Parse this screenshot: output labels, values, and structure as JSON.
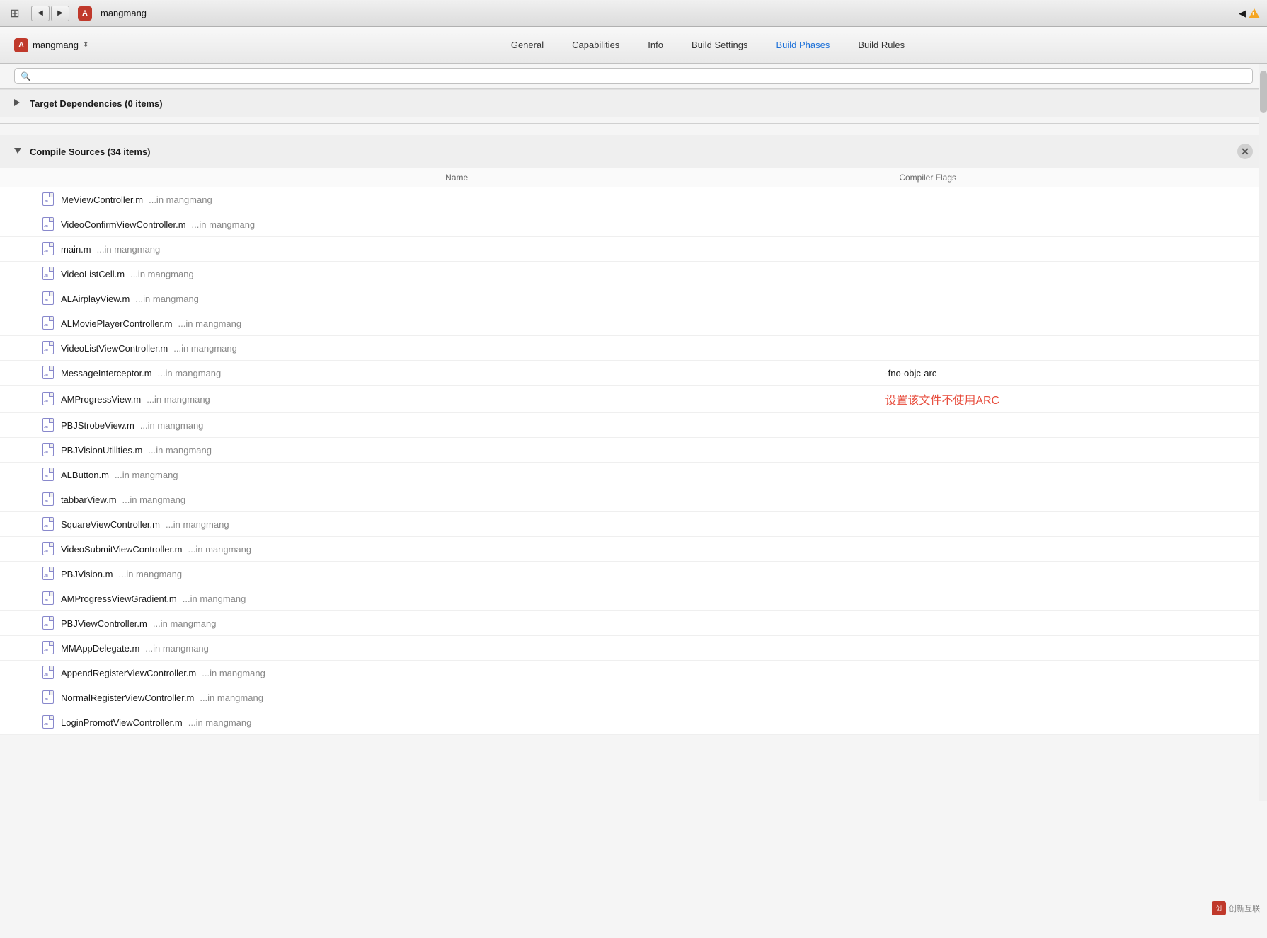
{
  "titlebar": {
    "title": "mangmang",
    "back_label": "◀",
    "forward_label": "▶"
  },
  "toolbar": {
    "project_name": "mangmang",
    "chevron": "⬍",
    "tabs": [
      {
        "label": "General",
        "active": false
      },
      {
        "label": "Capabilities",
        "active": false
      },
      {
        "label": "Info",
        "active": false
      },
      {
        "label": "Build Settings",
        "active": false
      },
      {
        "label": "Build Phases",
        "active": true
      },
      {
        "label": "Build Rules",
        "active": false
      }
    ]
  },
  "search": {
    "placeholder": ""
  },
  "sections": [
    {
      "title": "Target Dependencies (0 items)",
      "collapsed": true
    },
    {
      "title": "Compile Sources (34 items)",
      "collapsed": false
    }
  ],
  "table_headers": {
    "name": "Name",
    "compiler_flags": "Compiler Flags"
  },
  "files": [
    {
      "name": "MeViewController.m",
      "location": "...in mangmang",
      "flags": ""
    },
    {
      "name": "VideoConfirmViewController.m",
      "location": "...in mangmang",
      "flags": ""
    },
    {
      "name": "main.m",
      "location": "...in mangmang",
      "flags": ""
    },
    {
      "name": "VideoListCell.m",
      "location": "...in mangmang",
      "flags": ""
    },
    {
      "name": "ALAirplayView.m",
      "location": "...in mangmang",
      "flags": ""
    },
    {
      "name": "ALMoviePlayerController.m",
      "location": "...in mangmang",
      "flags": ""
    },
    {
      "name": "VideoListViewController.m",
      "location": "...in mangmang",
      "flags": ""
    },
    {
      "name": "MessageInterceptor.m",
      "location": "...in mangmang",
      "flags": "-fno-objc-arc"
    },
    {
      "name": "AMProgressView.m",
      "location": "...in mangmang",
      "flags": "设置该文件不使用ARC",
      "flags_type": "arc_note"
    },
    {
      "name": "PBJStrobeView.m",
      "location": "...in mangmang",
      "flags": ""
    },
    {
      "name": "PBJVisionUtilities.m",
      "location": "...in mangmang",
      "flags": ""
    },
    {
      "name": "ALButton.m",
      "location": "...in mangmang",
      "flags": ""
    },
    {
      "name": "tabbarView.m",
      "location": "...in mangmang",
      "flags": ""
    },
    {
      "name": "SquareViewController.m",
      "location": "...in mangmang",
      "flags": ""
    },
    {
      "name": "VideoSubmitViewController.m",
      "location": "...in mangmang",
      "flags": ""
    },
    {
      "name": "PBJVision.m",
      "location": "...in mangmang",
      "flags": ""
    },
    {
      "name": "AMProgressViewGradient.m",
      "location": "...in mangmang",
      "flags": ""
    },
    {
      "name": "PBJViewController.m",
      "location": "...in mangmang",
      "flags": ""
    },
    {
      "name": "MMAppDelegate.m",
      "location": "...in mangmang",
      "flags": ""
    },
    {
      "name": "AppendRegisterViewController.m",
      "location": "...in mangmang",
      "flags": ""
    },
    {
      "name": "NormalRegisterViewController.m",
      "location": "...in mangmang",
      "flags": ""
    },
    {
      "name": "LoginPromotViewController.m",
      "location": "...in mangmang",
      "flags": ""
    }
  ],
  "watermark": {
    "text": "创新互联",
    "sub": "C 创新互联"
  }
}
